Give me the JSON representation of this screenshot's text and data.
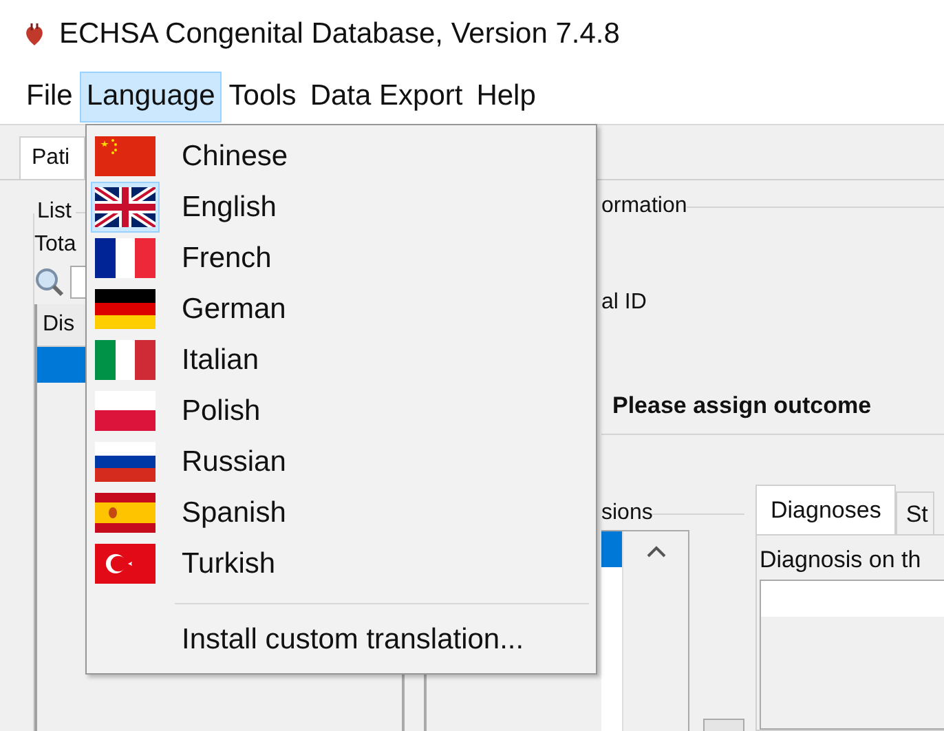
{
  "window": {
    "title": "ECHSA Congenital Database, Version 7.4.8"
  },
  "menu_bar": [
    {
      "label": "File",
      "selected": false
    },
    {
      "label": "Language",
      "selected": true
    },
    {
      "label": "Tools",
      "selected": false
    },
    {
      "label": "Data Export",
      "selected": false
    },
    {
      "label": "Help",
      "selected": false
    }
  ],
  "language_menu": {
    "items": [
      {
        "label": "Chinese",
        "kind": "cn",
        "selected": false
      },
      {
        "label": "English",
        "kind": "gb",
        "selected": true
      },
      {
        "label": "French",
        "kind": "fr",
        "selected": false
      },
      {
        "label": "German",
        "kind": "de",
        "selected": false
      },
      {
        "label": "Italian",
        "kind": "it",
        "selected": false
      },
      {
        "label": "Polish",
        "kind": "pl",
        "selected": false
      },
      {
        "label": "Russian",
        "kind": "ru",
        "selected": false
      },
      {
        "label": "Spanish",
        "kind": "es",
        "selected": false
      },
      {
        "label": "Turkish",
        "kind": "tr",
        "selected": false
      }
    ],
    "custom_item": "Install custom translation..."
  },
  "tabs": [
    {
      "label": "Pati",
      "selected": true
    }
  ],
  "patient_list": {
    "title": "List",
    "total_label": "Tota",
    "table": {
      "columns": [
        "Dis"
      ],
      "rows": [
        {
          "selected": true
        }
      ]
    }
  },
  "information": {
    "title": "ormation",
    "id_label": "al ID",
    "outcome_notice": "Please assign outcome"
  },
  "admissions": {
    "title": "sions",
    "rows": [
      {
        "selected": true
      }
    ]
  },
  "detail_tabs": [
    {
      "label": "Diagnoses",
      "selected": true
    },
    {
      "label": "St",
      "selected": false
    }
  ],
  "diagnosis_label": "Diagnosis on th"
}
